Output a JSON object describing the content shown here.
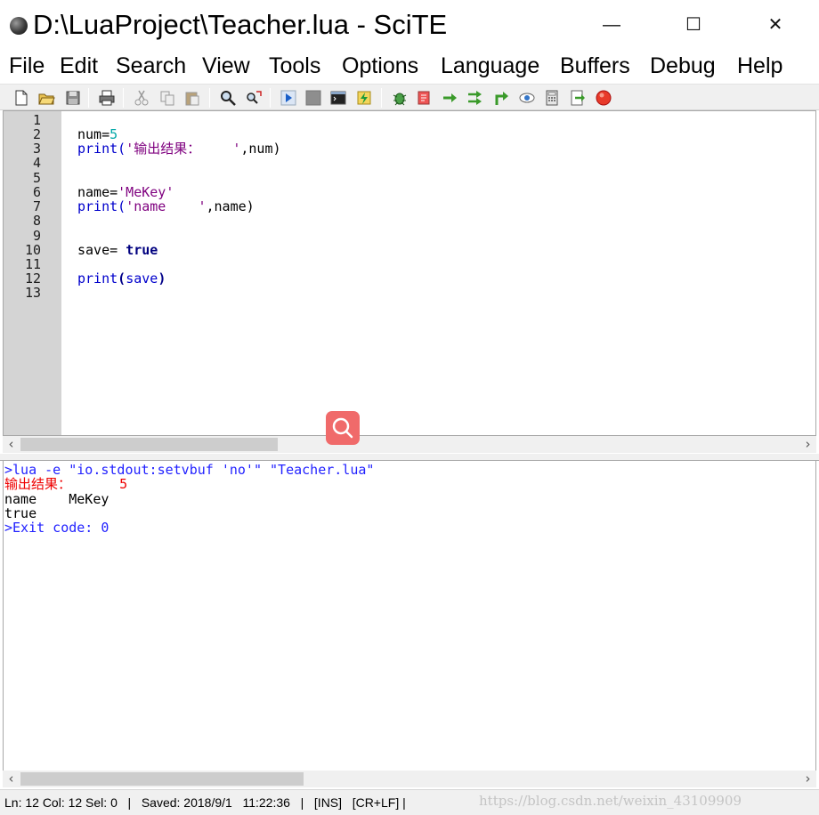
{
  "window": {
    "title": "D:\\LuaProject\\Teacher.lua - SciTE",
    "minimize_glyph": "—",
    "maximize_glyph": "☐",
    "close_glyph": "✕"
  },
  "menu": [
    "File",
    "Edit",
    "Search",
    "View",
    "Tools",
    "Options",
    "Language",
    "Buffers",
    "Debug",
    "Help"
  ],
  "toolbar_icons": [
    "new-file-icon",
    "open-folder-icon",
    "save-icon",
    "print-icon",
    "cut-icon",
    "copy-icon",
    "paste-icon",
    "find-icon",
    "replace-icon",
    "run-icon",
    "stop-icon",
    "console-icon",
    "compile-icon",
    "bug-icon",
    "breakpoint-icon",
    "step-over-icon",
    "step-into-icon",
    "step-out-icon",
    "watch-icon",
    "calculator-icon",
    "export-icon",
    "record-icon"
  ],
  "editor": {
    "line_numbers": [
      "1",
      "2",
      "3",
      "4",
      "5",
      "6",
      "7",
      "8",
      "9",
      "10",
      "11",
      "12",
      "13"
    ],
    "lines": [
      [],
      [
        {
          "t": "num=",
          "c": ""
        },
        {
          "t": "5",
          "c": "num"
        }
      ],
      [
        {
          "t": "print(",
          "c": "fn"
        },
        {
          "t": "'输出结果：    '",
          "c": "str"
        },
        {
          "t": ",num)",
          "c": ""
        }
      ],
      [],
      [],
      [
        {
          "t": "name=",
          "c": ""
        },
        {
          "t": "'MeKey'",
          "c": "str"
        }
      ],
      [
        {
          "t": "print(",
          "c": "fn"
        },
        {
          "t": "'name    '",
          "c": "str"
        },
        {
          "t": ",name)",
          "c": ""
        }
      ],
      [],
      [],
      [
        {
          "t": "save= ",
          "c": ""
        },
        {
          "t": "true",
          "c": "kw"
        }
      ],
      [],
      [
        {
          "t": "print",
          "c": "fn"
        },
        {
          "t": "(",
          "c": "paren"
        },
        {
          "t": "save",
          "c": "fn"
        },
        {
          "t": ")",
          "c": "paren"
        }
      ],
      []
    ]
  },
  "output": [
    {
      "text": ">lua -e \"io.stdout:setvbuf 'no'\" \"Teacher.lua\"",
      "color": "#2222ff"
    },
    {
      "text": "输出结果：      5",
      "color": "#ee0000"
    },
    {
      "text": "name    MeKey",
      "color": "#000000"
    },
    {
      "text": "true",
      "color": "#000000"
    },
    {
      "text": ">Exit code: 0",
      "color": "#2222ff"
    }
  ],
  "status": {
    "text": "Ln: 12 Col: 12 Sel: 0   |   Saved: 2018/9/1   11:22:36   |   [INS]   [CR+LF] |",
    "watermark": "https://blog.csdn.net/weixin_43109909"
  },
  "scroll": {
    "left_glyph": "‹",
    "right_glyph": "›"
  },
  "colors": {
    "search_fab": "#f06a6a",
    "gutter": "#d4d4d4",
    "chrome": "#f0f0f0"
  }
}
